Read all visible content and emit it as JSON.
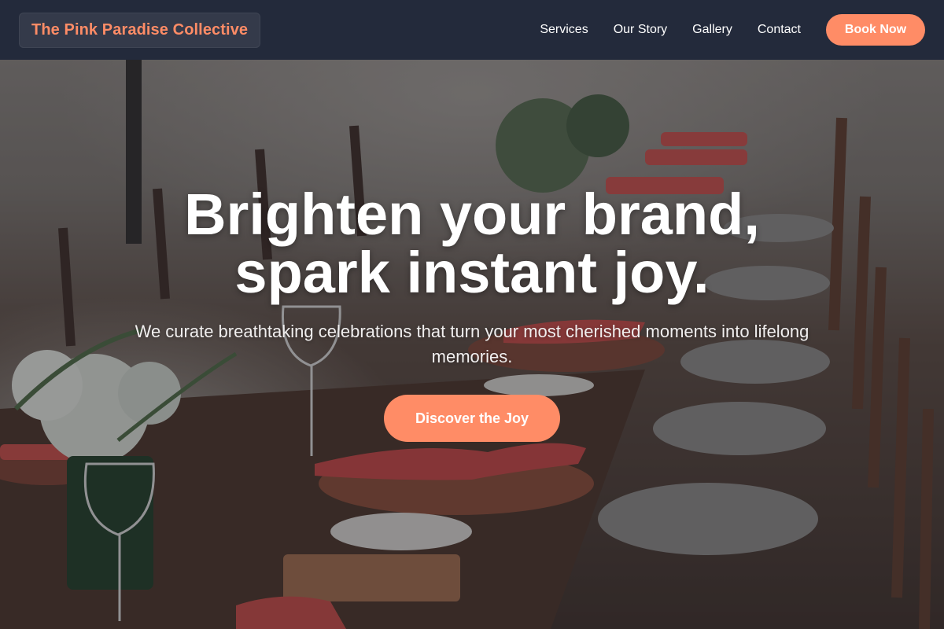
{
  "header": {
    "brand": "The Pink Paradise Collective",
    "nav": [
      {
        "label": "Services"
      },
      {
        "label": "Our Story"
      },
      {
        "label": "Gallery"
      },
      {
        "label": "Contact"
      }
    ],
    "cta_label": "Book Now"
  },
  "hero": {
    "headline_line1": "Brighten your brand,",
    "headline_line2": "spark instant joy.",
    "subheadline": "We curate breathtaking celebrations that turn your most cherished moments into lifelong memories.",
    "cta_label": "Discover the Joy"
  },
  "colors": {
    "accent": "#ff8c66",
    "header_bg": "#232a3b",
    "text_light": "#ffffff"
  }
}
